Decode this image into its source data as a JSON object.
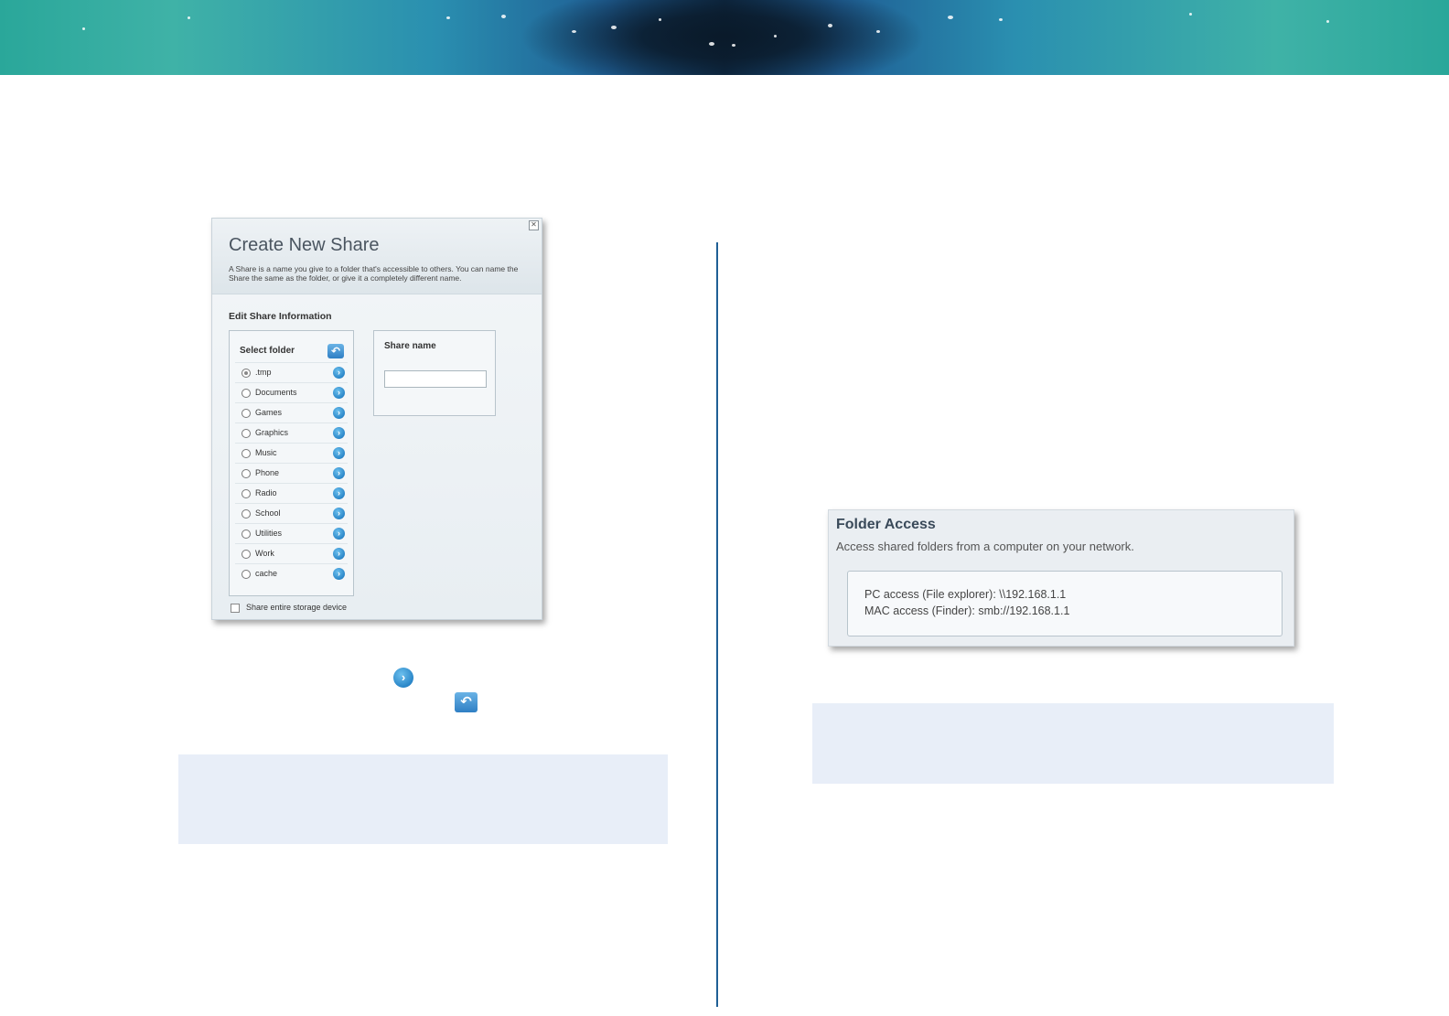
{
  "dialog": {
    "title": "Create New Share",
    "description": "A Share is a name you give to a folder that's accessible to others. You can name the Share the same as the folder, or give it a completely different name.",
    "close_icon": "close-icon",
    "section_title": "Edit Share Information",
    "select_folder_label": "Select folder",
    "folders": [
      {
        "name": ".tmp",
        "selected": true
      },
      {
        "name": "Documents",
        "selected": false
      },
      {
        "name": "Games",
        "selected": false
      },
      {
        "name": "Graphics",
        "selected": false
      },
      {
        "name": "Music",
        "selected": false
      },
      {
        "name": "Phone",
        "selected": false
      },
      {
        "name": "Radio",
        "selected": false
      },
      {
        "name": "School",
        "selected": false
      },
      {
        "name": "Utilities",
        "selected": false
      },
      {
        "name": "Work",
        "selected": false
      },
      {
        "name": "cache",
        "selected": false
      }
    ],
    "share_name_label": "Share name",
    "share_name_value": "",
    "share_entire_label": "Share entire storage device",
    "share_entire_checked": false
  },
  "folder_access": {
    "title": "Folder Access",
    "subtitle": "Access shared folders from a computer on your network.",
    "pc_access": "PC access (File explorer): \\\\192.168.1.1",
    "mac_access": "MAC access (Finder): smb://192.168.1.1"
  },
  "icons": {
    "arrow": "chevron-right-icon",
    "back": "back-arrow-icon"
  },
  "colors": {
    "accent_blue": "#2a86c8",
    "divider": "#1f5f95",
    "note_bg": "#e8eef8"
  }
}
